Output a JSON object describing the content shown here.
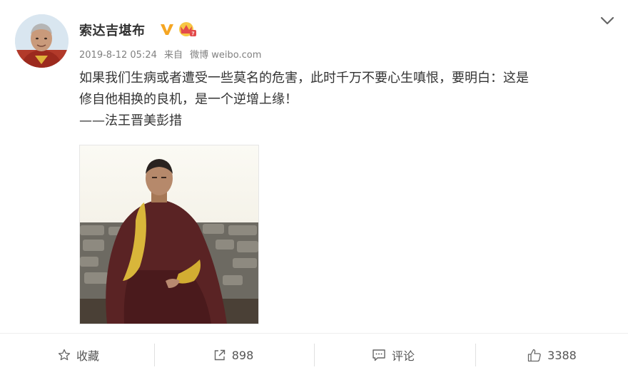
{
  "post": {
    "author": "索达吉堪布",
    "timestamp": "2019-8-12 05:24",
    "source_prefix": "来自",
    "source": "微博 weibo.com",
    "text_lines": [
      "如果我们生病或者遭受一些莫名的危害，此时千万不要心生嗔恨，要明白：这是",
      "修自他相换的良机，是一个逆增上缘！",
      "——法王晋美彭措"
    ]
  },
  "actions": {
    "favorite": "收藏",
    "repost_count": "898",
    "comment": "评论",
    "like_count": "3388"
  },
  "icons": {
    "vip": "verified-v-icon",
    "crown": "crown-badge-icon",
    "expand": "chevron-down-icon",
    "favorite": "star-icon",
    "repost": "share-arrow-icon",
    "comment": "comment-icon",
    "like": "thumbs-up-icon"
  },
  "colors": {
    "vip": "#f5a623",
    "crown": "#e34b4b",
    "text": "#333333",
    "meta": "#808080"
  }
}
